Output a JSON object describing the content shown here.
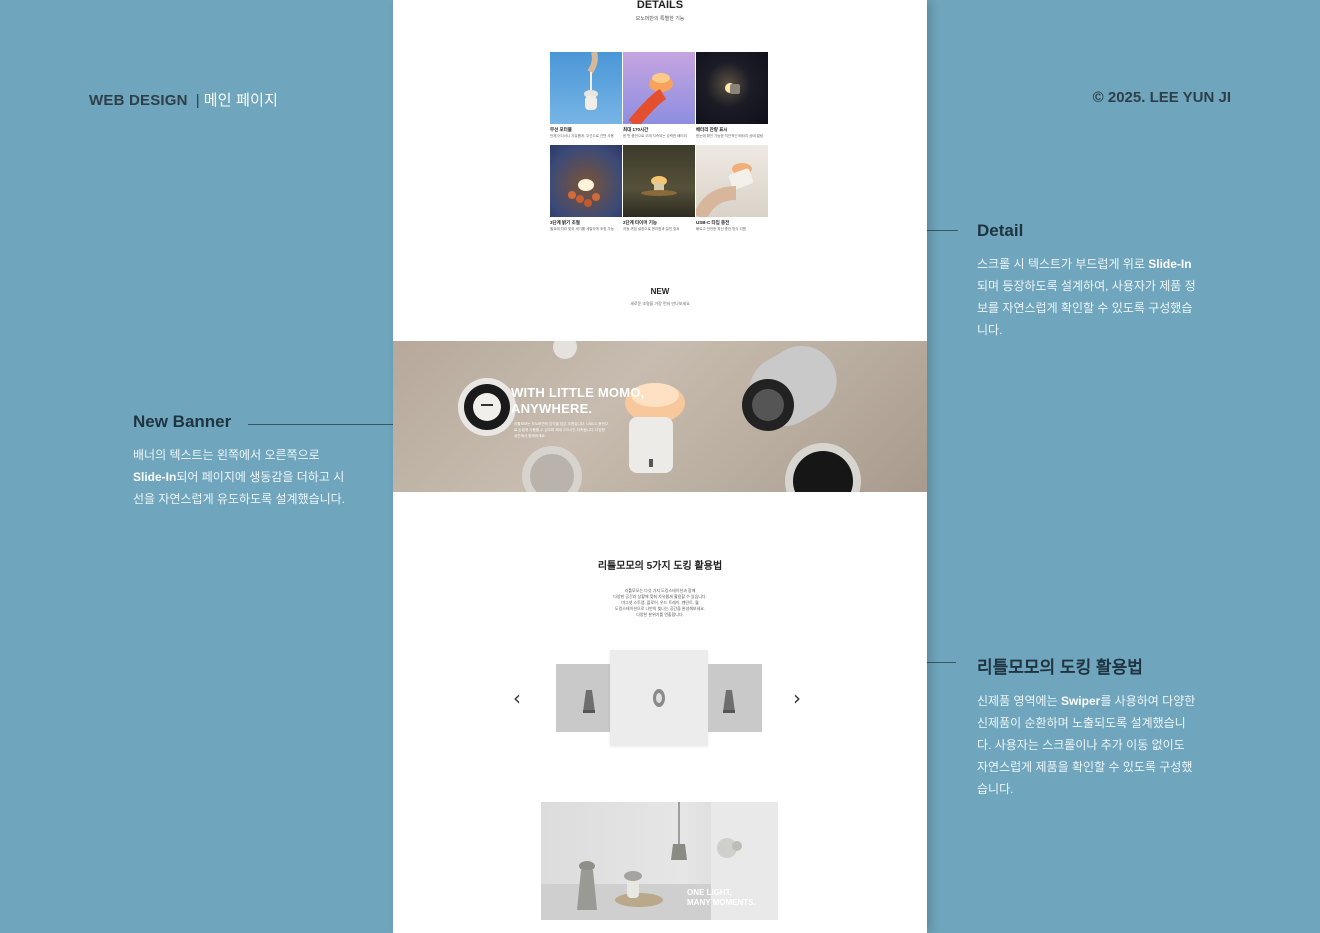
{
  "header": {
    "left_title": "WEB DESIGN",
    "left_sep": "|",
    "left_sub": "메인 페이지",
    "right": "© 2025. LEE YUN JI"
  },
  "annotations": {
    "detail": {
      "title": "Detail",
      "p1": "스크롤 시 텍스트가 부드럽게 위로 ",
      "p1_bold": "Slide-In",
      "p2": "되며 등장하도록 설계하여, 사용자가 제품 정보를 자연스럽게 확인할 수 있도록 구성했습니다."
    },
    "banner": {
      "title": "New Banner",
      "p1": "배너의 텍스트는 왼쪽에서 오른쪽으로 ",
      "p1_bold": "Slide-In",
      "p2": "되어 페이지에 생동감을 더하고 시선을 자연스럽게 유도하도록 설계했습니다."
    },
    "docking": {
      "title": "리틀모모의 도킹 활용법",
      "p1": "신제품 영역에는 ",
      "p1_bold": "Swiper",
      "p2": "를 사용하여 다양한 신제품이 순환하며 노출되도록 설계했습니다. 사용자는 스크롤이나 추가 이동 없이도 자연스럽게 제품을 확인할 수 있도록 구성했습니다."
    }
  },
  "page": {
    "details_title": "DETAILS",
    "details_sub": "모노머만의 특별한 기능",
    "grid": [
      {
        "cap": "무선 포터블",
        "desc": "언제 어디서나 자유롭게, 무선으로 간편 사용"
      },
      {
        "cap": "최대 170시간",
        "desc": "한 번 충전으로 오래 지속되는 강력한 배터리"
      },
      {
        "cap": "배터리 잔량 표시",
        "desc": "한눈에 확인 가능한 직관적인 배터리 상태 알림"
      },
      {
        "cap": "3단계 밝기 조절",
        "desc": "필요에 따라 빛의 세기를 세밀하게 조정 가능"
      },
      {
        "cap": "2단계 타이머 기능",
        "desc": "자동 꺼짐 설정으로 편리함과 절전 효과"
      },
      {
        "cap": "USB-C 타입 충전",
        "desc": "빠르고 안전한 최신 충전 방식 지원"
      }
    ],
    "new_title": "NEW",
    "new_sub": "새로운 조명을 가장 먼저 만나보세요",
    "banner_h1": "WITH LITTLE MOMO,",
    "banner_h2": "ANYWHERE.",
    "banner_text": "리틀모모는 모노머만의 감각을 담은 조명입니다. USB-C 충전으로 손쉽게 사용할 수 있으며 최대 170시간 지속됩니다. 다양한 공간에서 함께하세요.",
    "dock_title": "리틀모모의 5가지 도킹 활용법",
    "dock_desc_1": "리틀모모는 다섯 가지 도킹스테이션과 함께",
    "dock_desc_2": "다양한 공간과 상황에 맞춰 자유롭게 활용할 수 있습니다.",
    "dock_desc_3": "마그넷 스트랩, 플로어, 우드 트레이, 펜던트, 월",
    "dock_desc_4": "도킹스테이션으로 나만의 빛나는 공간을 완성해보세요.",
    "dock_desc_5": "다양한 분위기를 연출합니다.",
    "arrow_prev": "‹",
    "arrow_next": "›",
    "photo_text_1": "ONE LIGHT,",
    "photo_text_2": "MANY MOMENTS."
  },
  "colors": {
    "background": "#6fa6bd",
    "annotation_title": "#1f3340"
  }
}
